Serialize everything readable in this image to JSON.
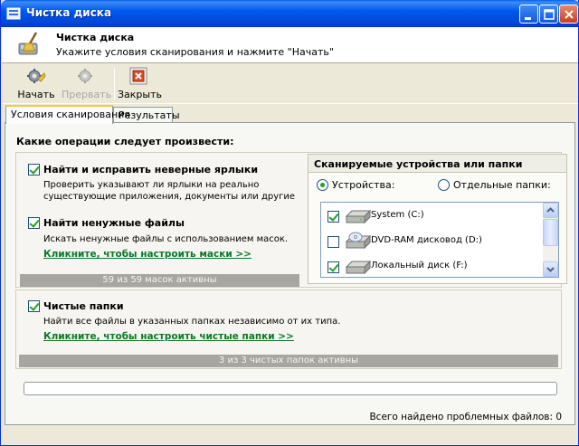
{
  "window": {
    "title": "Чистка диска"
  },
  "header": {
    "title": "Чистка диска",
    "subtitle": "Укажите условия сканирования и нажмите \"Начать\""
  },
  "toolbar": {
    "start_label": "Начать",
    "stop_label": "Прервать",
    "close_label": "Закрыть"
  },
  "tabs": [
    {
      "label": "Условия сканирования",
      "active": true
    },
    {
      "label": "Результаты",
      "active": false
    }
  ],
  "operations": {
    "heading": "Какие операции следует произвести:",
    "fix_shortcuts": {
      "label": "Найти и исправить неверные ярлыки",
      "checked": true,
      "description_line1": "Проверить указывают ли ярлыки на реально",
      "description_line2": "существующие приложения, документы или другие"
    },
    "junk_files": {
      "label": "Найти ненужные файлы",
      "checked": true,
      "description": "Искать ненужные файлы с использованием масок.",
      "link": "Кликните, чтобы настроить маски >>",
      "status": "59 из 59 масок активны"
    },
    "clean_folders": {
      "label": "Чистые папки",
      "checked": true,
      "description": "Найти все файлы в указанных папках независимо от их типа.",
      "link": "Кликните, чтобы настроить чистые папки >>",
      "status": "3 из 3 чистых папок активны"
    }
  },
  "scan_targets": {
    "heading": "Сканируемые устройства или папки",
    "radio_devices": "Устройства:",
    "radio_folders": "Отдельные папки:",
    "selected": "devices",
    "drives": [
      {
        "name": "System (C:)",
        "checked": true,
        "icon": "hard-drive-icon"
      },
      {
        "name": "DVD-RAM дисковод (D:)",
        "checked": false,
        "icon": "dvd-drive-icon"
      },
      {
        "name": "Локальный диск (F:)",
        "checked": true,
        "icon": "hard-drive-icon"
      }
    ]
  },
  "progress": {
    "value": 0
  },
  "footer": {
    "found_text": "Всего найдено проблемных файлов: 0"
  },
  "colors": {
    "titlebar": "#0058EE",
    "link": "#0A7A2A",
    "check": "#21A121",
    "status_bar": "#A7A6A0"
  }
}
